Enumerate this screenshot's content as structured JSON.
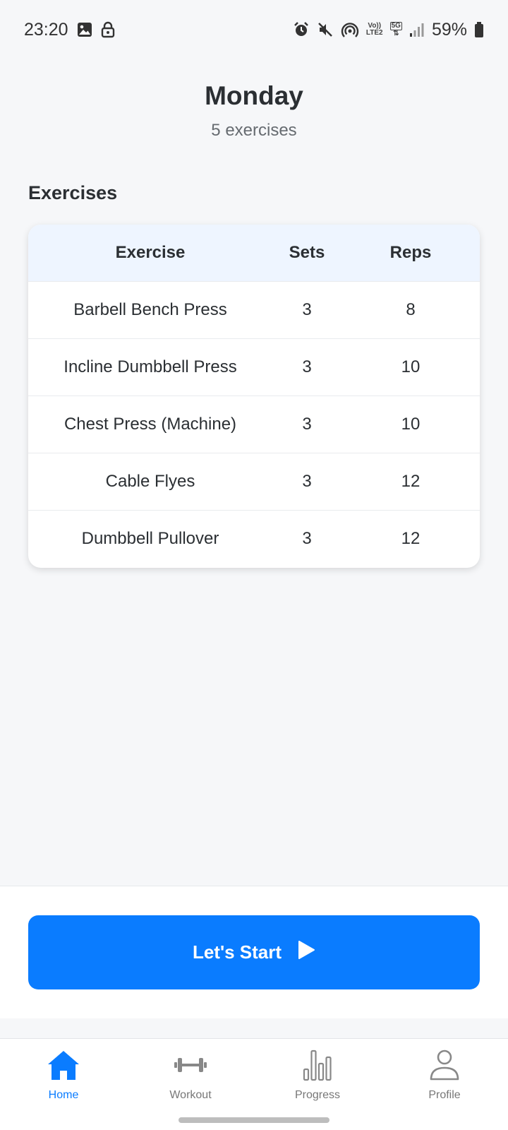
{
  "status_bar": {
    "time": "23:20",
    "battery": "59%",
    "network_volte": "Vo))",
    "network_lte": "LTE2",
    "network_5g": "5G"
  },
  "header": {
    "day": "Monday",
    "exercise_count": "5 exercises"
  },
  "section": {
    "title": "Exercises"
  },
  "table": {
    "headers": [
      "Exercise",
      "Sets",
      "Reps"
    ],
    "rows": [
      {
        "exercise": "Barbell Bench Press",
        "sets": "3",
        "reps": "8"
      },
      {
        "exercise": "Incline Dumbbell Press",
        "sets": "3",
        "reps": "10"
      },
      {
        "exercise": "Chest Press (Machine)",
        "sets": "3",
        "reps": "10"
      },
      {
        "exercise": "Cable Flyes",
        "sets": "3",
        "reps": "12"
      },
      {
        "exercise": "Dumbbell Pullover",
        "sets": "3",
        "reps": "12"
      }
    ]
  },
  "start_button": {
    "label": "Let's Start",
    "icon": "play-icon"
  },
  "nav": {
    "items": [
      {
        "label": "Home",
        "icon": "home-icon",
        "active": true
      },
      {
        "label": "Workout",
        "icon": "dumbbell-icon",
        "active": false
      },
      {
        "label": "Progress",
        "icon": "bar-chart-icon",
        "active": false
      },
      {
        "label": "Profile",
        "icon": "user-icon",
        "active": false
      }
    ]
  },
  "colors": {
    "accent": "#0a7cff",
    "table_header_bg": "#eef5ff",
    "background": "#f6f7f9"
  }
}
